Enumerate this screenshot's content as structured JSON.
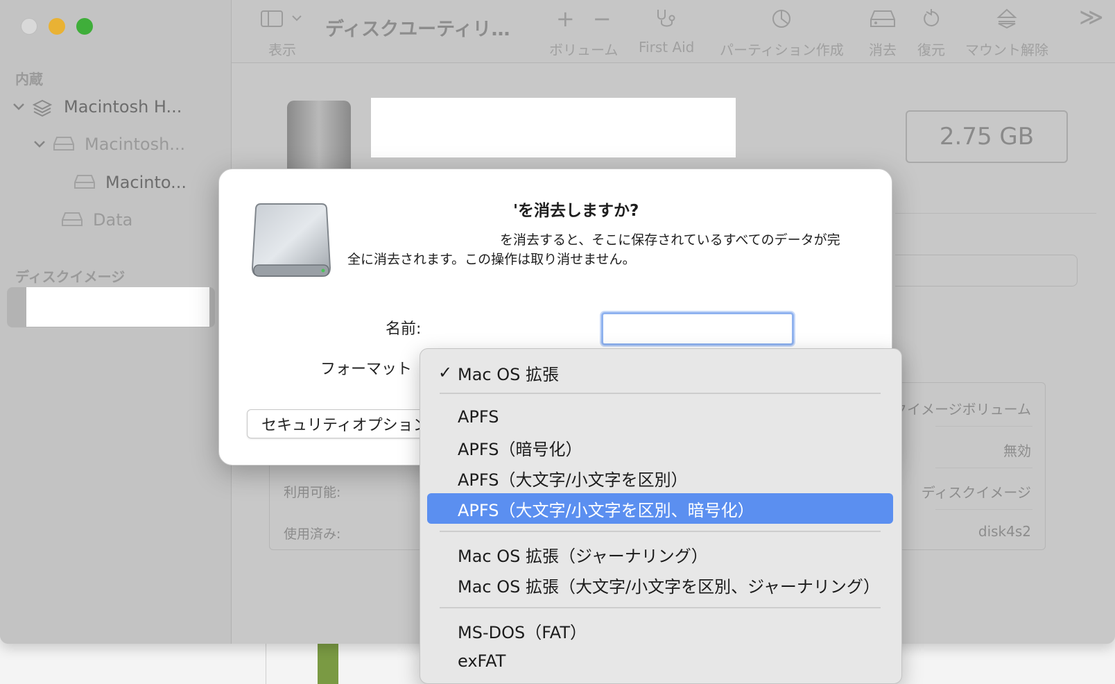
{
  "sidebar": {
    "section_internal": "内蔵",
    "items": [
      {
        "label": "Macintosh H..."
      },
      {
        "label": "Macintosh..."
      },
      {
        "label": "Macinto..."
      },
      {
        "label": "Data"
      }
    ],
    "section_images": "ディスクイメージ"
  },
  "toolbar": {
    "view_label": "表示",
    "title": "ディスクユーティリ…",
    "volume_label": "ボリューム",
    "firstaid_label": "First Aid",
    "partition_label": "パーティション作成",
    "erase_label": "消去",
    "restore_label": "復元",
    "unmount_label": "マウント解除",
    "plus": "+",
    "minus": "−",
    "more": "≫"
  },
  "main": {
    "size": "2.75 GB",
    "info": {
      "available_label": "利用可能:",
      "used_label": "使用済み:",
      "type_value": "スクイメージボリューム",
      "owners_value": "無効",
      "connection_value": "ディスクイメージ",
      "device_value": "disk4s2"
    }
  },
  "dialog": {
    "title": "'を消去しますか?",
    "body_line1": "を消去すると、そこに保存されているすべてのデータが完",
    "body_line2": "全に消去されます。この操作は取り消せません。",
    "name_label": "名前:",
    "format_label": "フォーマット",
    "security_button": "セキュリティオプション"
  },
  "format_menu": {
    "checkmark": "✓",
    "items": [
      {
        "label": "Mac OS 拡張",
        "checked": true
      },
      {
        "label": "APFS"
      },
      {
        "label": "APFS（暗号化）"
      },
      {
        "label": "APFS（大文字/小文字を区別）"
      },
      {
        "label": "APFS（大文字/小文字を区別、暗号化）",
        "highlighted": true
      },
      {
        "label": "Mac OS 拡張（ジャーナリング）"
      },
      {
        "label": "Mac OS 拡張（大文字/小文字を区別、ジャーナリング）"
      },
      {
        "label": "MS-DOS（FAT）"
      },
      {
        "label": "exFAT"
      }
    ]
  },
  "colors": {
    "highlight": "#5b8ff0",
    "focus_ring": "#8fb2ef",
    "close": "#d9d9d9",
    "minimize": "#e9b234",
    "maximize": "#3fae3a"
  }
}
